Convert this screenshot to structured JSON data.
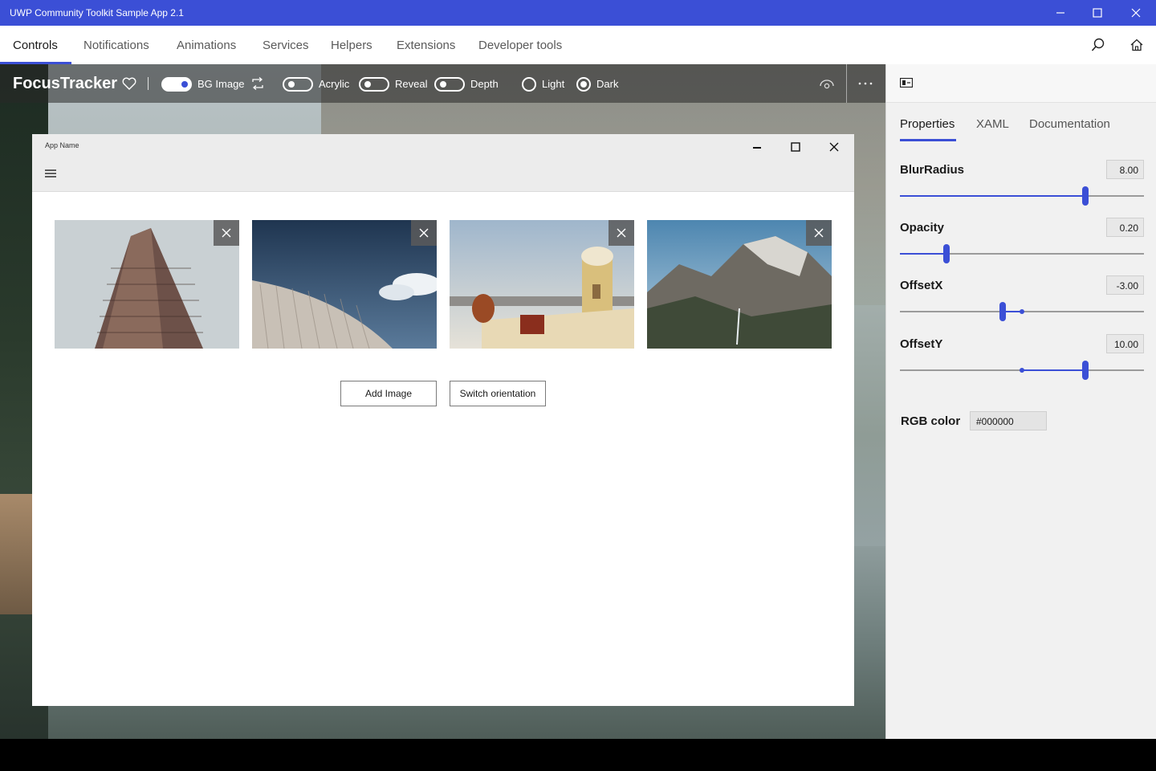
{
  "window": {
    "title": "UWP Community Toolkit Sample App 2.1"
  },
  "nav": {
    "items": [
      "Controls",
      "Notifications",
      "Animations",
      "Services",
      "Helpers",
      "Extensions",
      "Developer tools"
    ],
    "active": "Controls"
  },
  "toolbar": {
    "title": "FocusTracker",
    "bg_image_label": "BG Image",
    "bg_image_on": true,
    "acrylic_label": "Acrylic",
    "acrylic_on": false,
    "reveal_label": "Reveal",
    "reveal_on": false,
    "depth_label": "Depth",
    "depth_on": false,
    "light_label": "Light",
    "dark_label": "Dark",
    "theme_selected": "Dark"
  },
  "inner_window": {
    "title": "App Name",
    "images": [
      {
        "name": "flatiron-building"
      },
      {
        "name": "curved-facade"
      },
      {
        "name": "santorini-tower"
      },
      {
        "name": "yosemite-valley"
      }
    ],
    "add_image_label": "Add Image",
    "switch_orientation_label": "Switch orientation"
  },
  "panel": {
    "tabs": [
      "Properties",
      "XAML",
      "Documentation"
    ],
    "active_tab": "Properties",
    "properties": [
      {
        "label": "BlurRadius",
        "value": "8.00",
        "fraction": 0.76,
        "range_start": null
      },
      {
        "label": "Opacity",
        "value": "0.20",
        "fraction": 0.19,
        "range_start": null
      },
      {
        "label": "OffsetX",
        "value": "-3.00",
        "fraction": 0.42,
        "range_start": 0.5
      },
      {
        "label": "OffsetY",
        "value": "10.00",
        "fraction": 0.76,
        "range_start": 0.5
      }
    ],
    "rgb_label": "RGB color",
    "rgb_value": "#000000"
  },
  "colors": {
    "accent": "#3b4fd6"
  }
}
